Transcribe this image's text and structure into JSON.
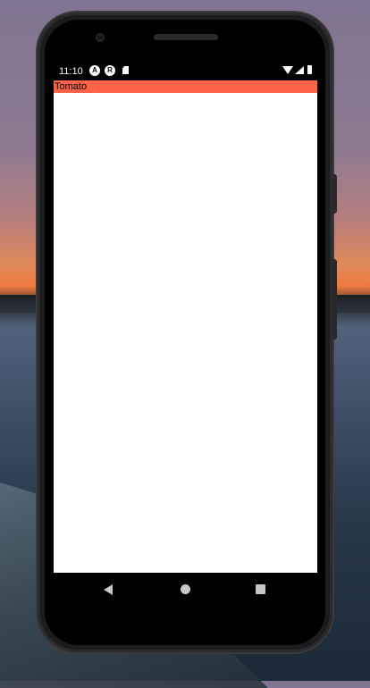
{
  "status_bar": {
    "time": "11:10",
    "icons": [
      "app-a-icon",
      "app-r-icon",
      "sd-card-icon",
      "wifi-icon",
      "signal-icon",
      "battery-icon"
    ]
  },
  "screen": {
    "banner_text": "Tomato",
    "banner_color": "#ff6347",
    "background": "#ffffff"
  },
  "nav_bar": {
    "buttons": [
      "back-icon",
      "home-icon",
      "recents-icon"
    ]
  }
}
